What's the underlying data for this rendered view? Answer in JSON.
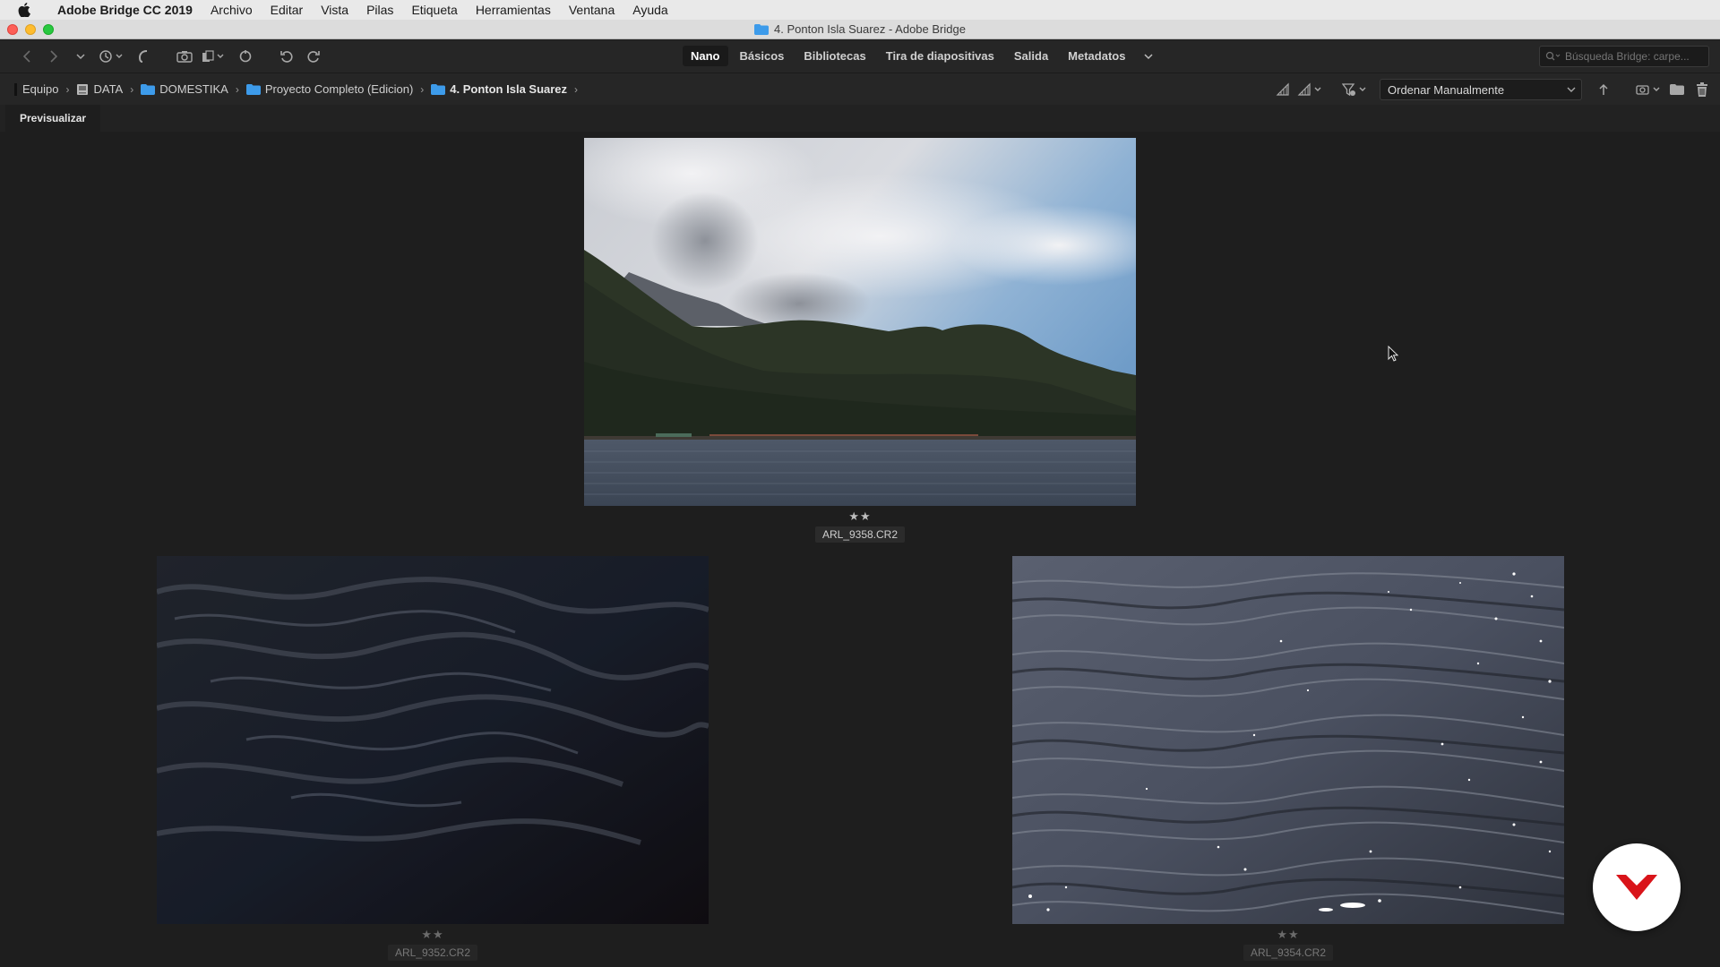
{
  "menubar": {
    "app_name": "Adobe Bridge CC 2019",
    "items": [
      "Archivo",
      "Editar",
      "Vista",
      "Pilas",
      "Etiqueta",
      "Herramientas",
      "Ventana",
      "Ayuda"
    ]
  },
  "window": {
    "title": "4. Ponton Isla Suarez - Adobe Bridge"
  },
  "toolbar": {
    "workspaces": [
      "Nano",
      "Básicos",
      "Bibliotecas",
      "Tira de diapositivas",
      "Salida",
      "Metadatos"
    ],
    "active_workspace": "Nano",
    "search_placeholder": "Búsqueda Bridge: carpe..."
  },
  "path": {
    "crumbs": [
      "Equipo",
      "DATA",
      "DOMESTIKA",
      "Proyecto Completo (Edicion)",
      "4. Ponton Isla Suarez"
    ],
    "sort_label": "Ordenar Manualmente"
  },
  "panel": {
    "tab_label": "Previsualizar"
  },
  "photos": [
    {
      "filename": "ARL_9358.CR2",
      "stars": "★★",
      "rating": 2,
      "subject": "lake-mountains-clouds"
    },
    {
      "filename": "ARL_9352.CR2",
      "stars": "★★",
      "rating": 2,
      "subject": "dark-water-ripples"
    },
    {
      "filename": "ARL_9354.CR2",
      "stars": "★★",
      "rating": 2,
      "subject": "sparkling-water-surface"
    }
  ],
  "colors": {
    "accent_folder": "#3d9bea",
    "logo_red": "#d9141a"
  }
}
